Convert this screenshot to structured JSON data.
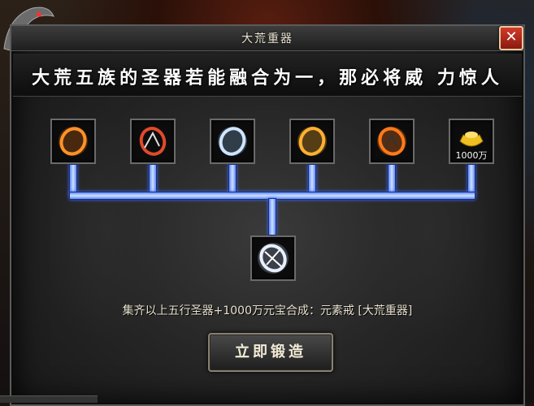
{
  "window": {
    "title": "大荒重器",
    "banner": "大荒五族的圣器若能融合为一，那必将威 力惊人",
    "close_label": "✕"
  },
  "materials": [
    {
      "name": "ring-gold-flame",
      "color": "#ff9a2a"
    },
    {
      "name": "ring-red-dragon",
      "color": "#e04a2a"
    },
    {
      "name": "ring-silver-frost",
      "color": "#cfe6ff"
    },
    {
      "name": "ring-golden-fire",
      "color": "#ffb030"
    },
    {
      "name": "ring-orange-blaze",
      "color": "#ff7a1a"
    },
    {
      "name": "gold-ingot",
      "color": "#f0c020",
      "quantity": "1000万"
    }
  ],
  "result": {
    "name": "element-ring",
    "color": "#e8f0ff"
  },
  "description": "集齐以上五行圣器+1000万元宝合成：元素戒 [大荒重器]",
  "forge_button": "立即锻造",
  "colors": {
    "connector": "#5e8cff",
    "panel": "#262626"
  }
}
